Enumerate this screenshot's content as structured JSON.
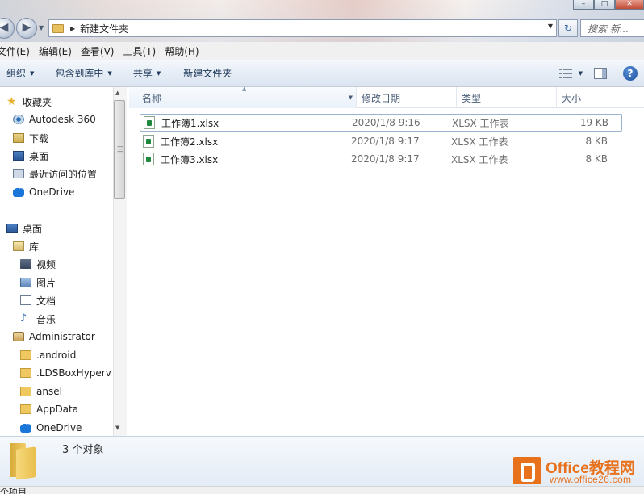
{
  "window": {
    "minimize_glyph": "–",
    "maximize_glyph": "□",
    "close_glyph": "✕"
  },
  "address": {
    "path": "新建文件夹",
    "search_placeholder": "搜索 新..."
  },
  "menu": [
    "文件(E)",
    "编辑(E)",
    "查看(V)",
    "工具(T)",
    "帮助(H)"
  ],
  "toolbar": {
    "organize": "组织",
    "include_library": "包含到库中",
    "share": "共享",
    "new_folder": "新建文件夹"
  },
  "sidebar": {
    "favorites": [
      {
        "label": "收藏夹",
        "icon": "star-icon"
      },
      {
        "label": "Autodesk 360",
        "icon": "autodesk-icon"
      },
      {
        "label": "下载",
        "icon": "downloads-icon"
      },
      {
        "label": "桌面",
        "icon": "desktop-icon"
      },
      {
        "label": "最近访问的位置",
        "icon": "recent-places-icon"
      },
      {
        "label": "OneDrive",
        "icon": "onedrive-icon"
      }
    ],
    "tree": [
      {
        "label": "桌面",
        "icon": "desktop-icon"
      },
      {
        "label": "库",
        "icon": "libraries-icon"
      },
      {
        "label": "视频",
        "icon": "videos-icon"
      },
      {
        "label": "图片",
        "icon": "pictures-icon"
      },
      {
        "label": "文档",
        "icon": "documents-icon"
      },
      {
        "label": "音乐",
        "icon": "music-icon"
      },
      {
        "label": "Administrator",
        "icon": "user-folder-icon"
      },
      {
        "label": ".android",
        "icon": "folder-icon"
      },
      {
        "label": ".LDSBoxHyperv",
        "icon": "folder-icon"
      },
      {
        "label": "ansel",
        "icon": "folder-icon"
      },
      {
        "label": "AppData",
        "icon": "folder-icon"
      },
      {
        "label": "OneDrive",
        "icon": "onedrive-icon"
      }
    ]
  },
  "columns": {
    "name": "名称",
    "date": "修改日期",
    "type": "类型",
    "size": "大小"
  },
  "files": [
    {
      "name": "工作簿1.xlsx",
      "date": "2020/1/8 9:16",
      "type": "XLSX 工作表",
      "size": "19 KB"
    },
    {
      "name": "工作簿2.xlsx",
      "date": "2020/1/8 9:17",
      "type": "XLSX 工作表",
      "size": "8 KB"
    },
    {
      "name": "工作簿3.xlsx",
      "date": "2020/1/8 9:17",
      "type": "XLSX 工作表",
      "size": "8 KB"
    }
  ],
  "details": {
    "count": "3 个对象"
  },
  "status": {
    "text": "个项目"
  },
  "watermark": {
    "title": "Office教程网",
    "url": "www.office26.com"
  },
  "colors": {
    "accent_orange": "#e8711c",
    "excel_green": "#1f8a3e",
    "folder_yellow": "#efc95f"
  }
}
